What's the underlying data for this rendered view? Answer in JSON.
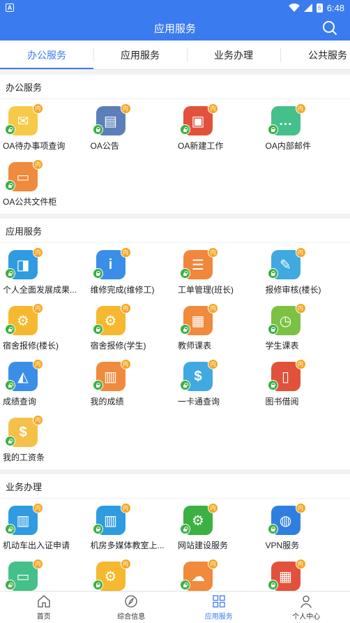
{
  "status": {
    "time": "6:48",
    "battery": "6"
  },
  "appbar": {
    "title": "应用服务"
  },
  "tabs": [
    {
      "label": "办公服务",
      "active": true
    },
    {
      "label": "应用服务",
      "active": false
    },
    {
      "label": "业务办理",
      "active": false
    },
    {
      "label": "公共服务",
      "active": false
    }
  ],
  "badge_text": "内",
  "sections": [
    {
      "title": "办公服务",
      "items": [
        {
          "label": "OA待办事项查询",
          "icon": "documents-icon",
          "color": "#f7c948"
        },
        {
          "label": "OA公告",
          "icon": "notice-icon",
          "color": "#5b7fb8"
        },
        {
          "label": "OA新建工作",
          "icon": "briefcase-icon",
          "color": "#e2513b"
        },
        {
          "label": "OA内部邮件",
          "icon": "chat-icon",
          "color": "#45c08a"
        },
        {
          "label": "OA公共文件柜",
          "icon": "cabinet-icon",
          "color": "#f08a3c"
        }
      ]
    },
    {
      "title": "应用服务",
      "items": [
        {
          "label": "个人全面发展成果...",
          "icon": "chart-board-icon",
          "color": "#2f9be0"
        },
        {
          "label": "维修完成(维修工)",
          "icon": "info-icon",
          "color": "#3b8ee8"
        },
        {
          "label": "工单管理(班长)",
          "icon": "list-icon",
          "color": "#f0873c"
        },
        {
          "label": "报修审核(楼长)",
          "icon": "pen-icon",
          "color": "#3fa9e0"
        },
        {
          "label": "宿舍报修(楼长)",
          "icon": "wrench-icon",
          "color": "#f5b82e"
        },
        {
          "label": "宿舍报修(学生)",
          "icon": "wrench-icon",
          "color": "#f5b82e"
        },
        {
          "label": "教师课表",
          "icon": "calendar-icon",
          "color": "#f08a3c"
        },
        {
          "label": "学生课表",
          "icon": "calendar-clock-icon",
          "color": "#7cc242"
        },
        {
          "label": "成绩查询",
          "icon": "graph-icon",
          "color": "#3b8ee8"
        },
        {
          "label": "我的成绩",
          "icon": "report-icon",
          "color": "#f08a3c"
        },
        {
          "label": "一卡通查询",
          "icon": "coin-icon",
          "color": "#3fa9e0"
        },
        {
          "label": "图书借阅",
          "icon": "book-icon",
          "color": "#e2513b"
        },
        {
          "label": "我的工资条",
          "icon": "money-icon",
          "color": "#f5c04a"
        }
      ]
    },
    {
      "title": "业务办理",
      "items": [
        {
          "label": "机动车出入证申请",
          "icon": "building-icon",
          "color": "#2f9be0"
        },
        {
          "label": "机房多媒体教室上...",
          "icon": "building-icon",
          "color": "#2f9be0"
        },
        {
          "label": "网站建设服务",
          "icon": "gear-icon",
          "color": "#3cb043"
        },
        {
          "label": "VPN服务",
          "icon": "globe-icon",
          "color": "#2f7fe0"
        },
        {
          "label": "",
          "icon": "laptop-icon",
          "color": "#45c08a"
        },
        {
          "label": "",
          "icon": "wrench-icon",
          "color": "#f5b82e"
        },
        {
          "label": "",
          "icon": "cloud-upload-icon",
          "color": "#f08a3c"
        },
        {
          "label": "",
          "icon": "calendar-grid-icon",
          "color": "#e2513b"
        }
      ]
    }
  ],
  "bottom_nav": [
    {
      "label": "首页",
      "icon": "home-icon",
      "active": false
    },
    {
      "label": "综合信息",
      "icon": "compass-icon",
      "active": false
    },
    {
      "label": "应用服务",
      "icon": "grid-icon",
      "active": true
    },
    {
      "label": "个人中心",
      "icon": "person-icon",
      "active": false
    }
  ]
}
